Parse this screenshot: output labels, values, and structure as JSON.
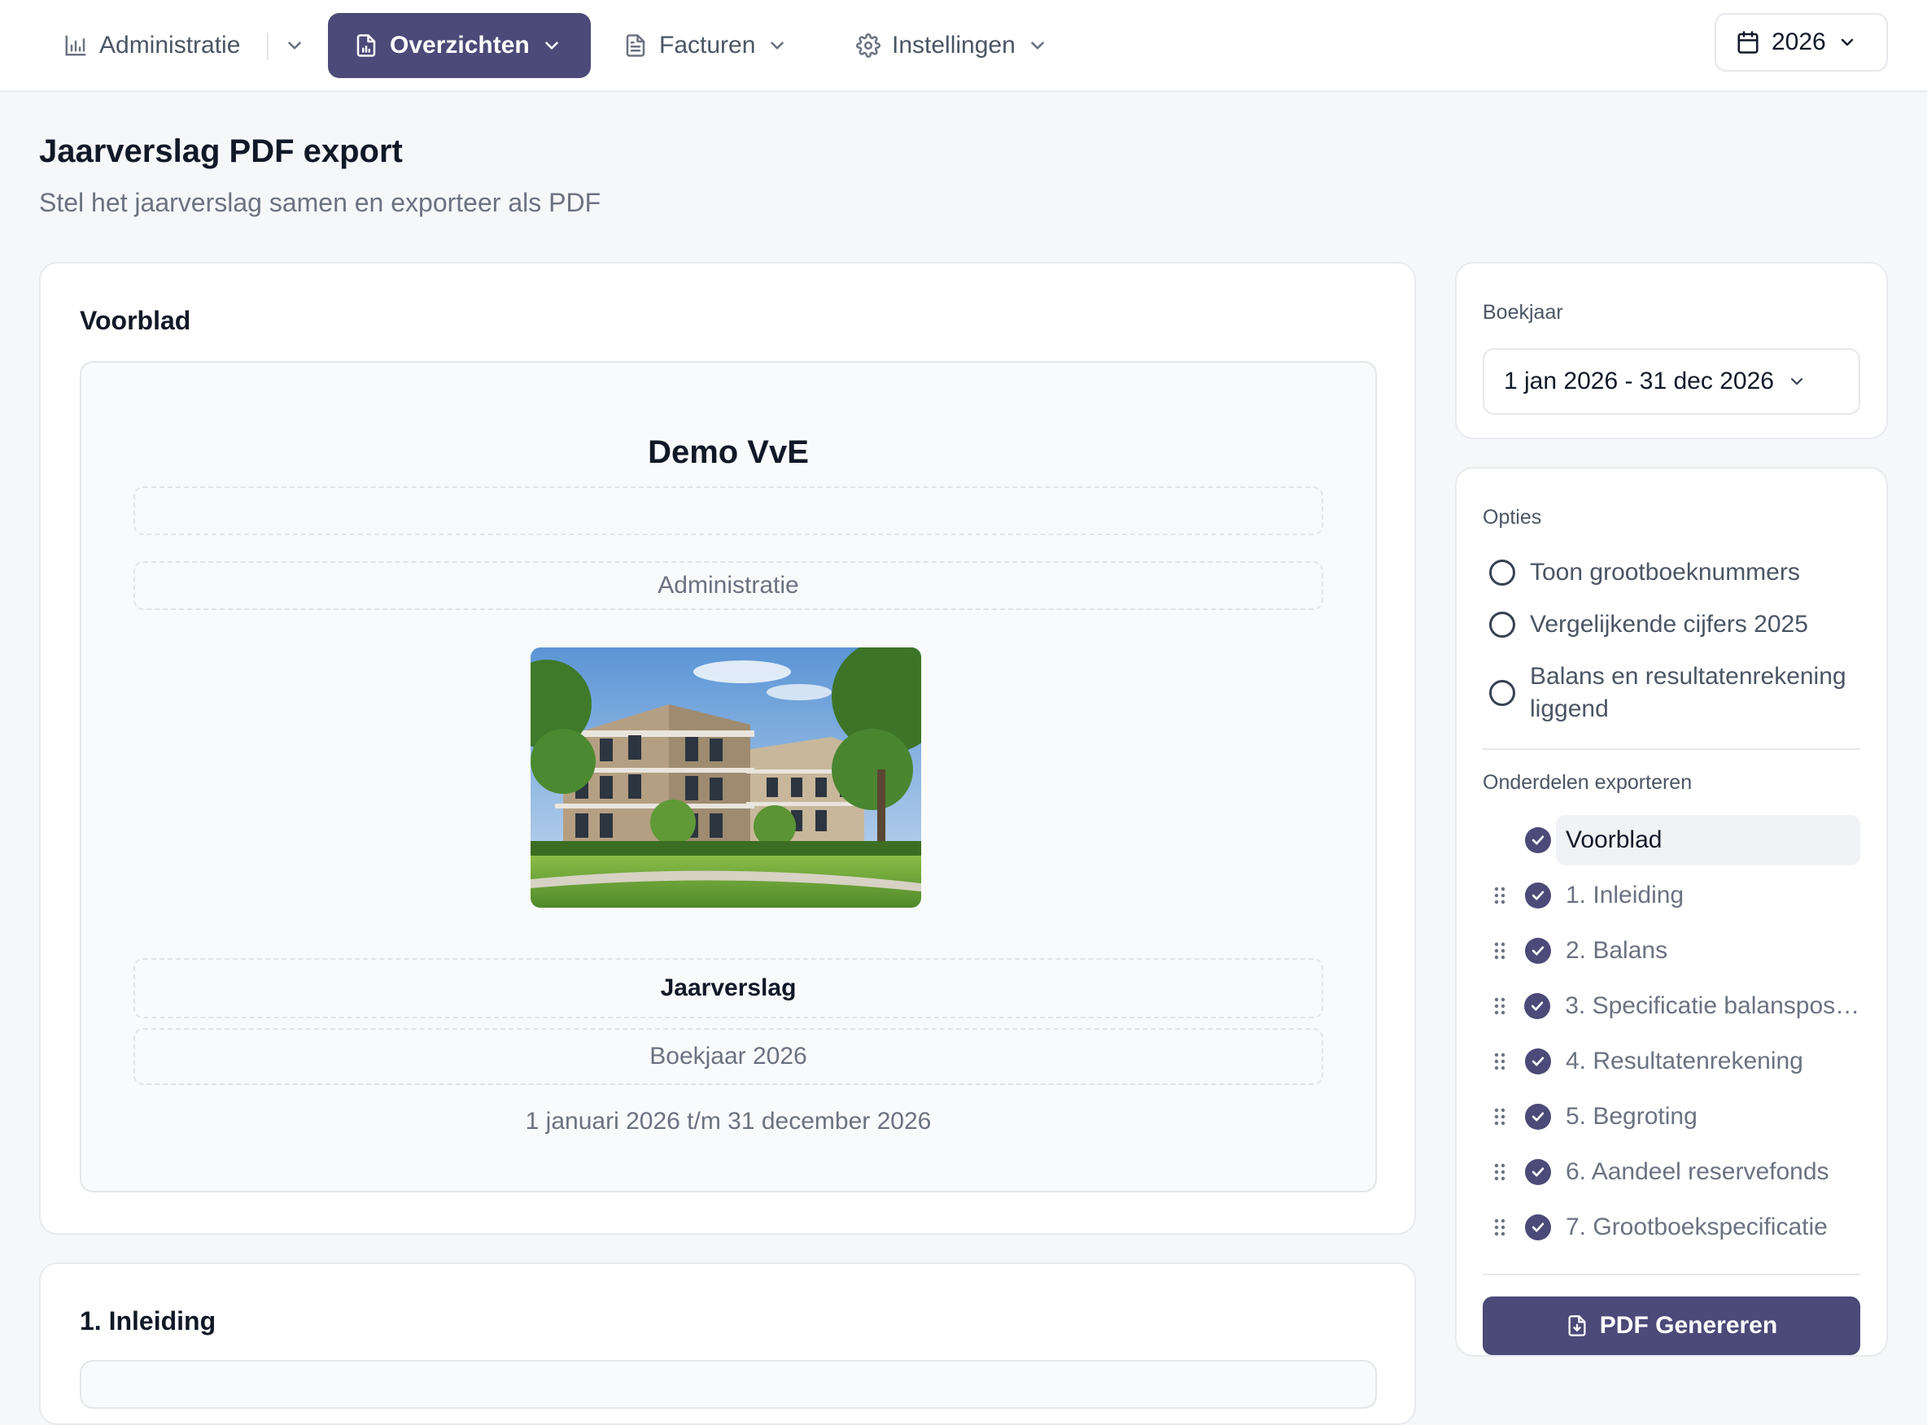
{
  "nav": {
    "items": [
      {
        "label": "Administratie",
        "icon": "bar-chart-icon"
      },
      {
        "label": "Overzichten",
        "icon": "file-chart-icon",
        "active": true
      },
      {
        "label": "Facturen",
        "icon": "file-text-icon"
      },
      {
        "label": "Instellingen",
        "icon": "gear-icon"
      }
    ],
    "year": "2026",
    "accent_color": "#4b4a78"
  },
  "header": {
    "title": "Jaarverslag PDF export",
    "subtitle": "Stel het jaarverslag samen en exporteer als PDF"
  },
  "voorblad": {
    "heading": "Voorblad",
    "name": "Demo VvE",
    "line1": "",
    "administratie": "Administratie",
    "image": "apartment-building-photo",
    "document_title": "Jaarverslag",
    "boekjaar": "Boekjaar 2026",
    "period": "1 januari 2026 t/m 31 december 2026"
  },
  "inleiding": {
    "heading": "1. Inleiding"
  },
  "sidebar": {
    "boekjaar_label": "Boekjaar",
    "boekjaar_value": "1 jan 2026 - 31 dec 2026",
    "opties_label": "Opties",
    "opties": [
      {
        "label": "Toon grootboeknummers",
        "checked": false
      },
      {
        "label": "Vergelijkende cijfers 2025",
        "checked": false
      },
      {
        "label": "Balans en resultatenrekening liggend",
        "checked": false
      }
    ],
    "onderdelen_label": "Onderdelen exporteren",
    "onderdelen": [
      {
        "label": "Voorblad",
        "checked": true
      },
      {
        "label": "1. Inleiding",
        "checked": true
      },
      {
        "label": "2. Balans",
        "checked": true
      },
      {
        "label": "3. Specificatie balansposten",
        "checked": true
      },
      {
        "label": "4. Resultatenrekening",
        "checked": true
      },
      {
        "label": "5. Begroting",
        "checked": true
      },
      {
        "label": "6. Aandeel reservefonds",
        "checked": true
      },
      {
        "label": "7. Grootboekspecificatie",
        "checked": true
      }
    ],
    "pdf_button": "PDF Genereren"
  }
}
